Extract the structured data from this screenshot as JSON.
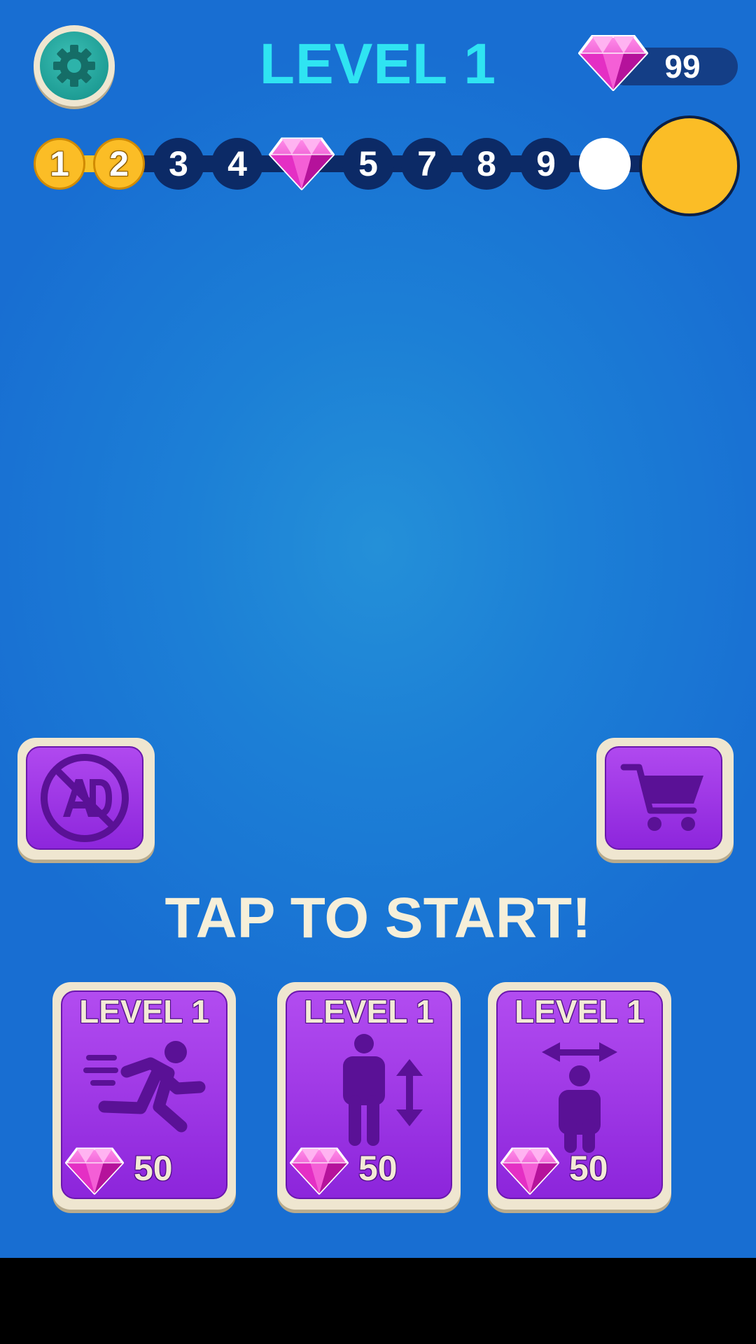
{
  "header": {
    "title": "LEVEL 1",
    "gem_count": "99",
    "settings_icon": "gear-icon",
    "gem_icon": "gem-icon"
  },
  "progress": {
    "nodes": [
      {
        "label": "1",
        "state": "completed"
      },
      {
        "label": "2",
        "state": "completed"
      },
      {
        "label": "3",
        "state": "upcoming"
      },
      {
        "label": "4",
        "state": "upcoming"
      },
      {
        "label": "",
        "state": "gem-reward",
        "icon": "gem-icon"
      },
      {
        "label": "5",
        "state": "upcoming"
      },
      {
        "label": "7",
        "state": "upcoming"
      },
      {
        "label": "8",
        "state": "upcoming"
      },
      {
        "label": "9",
        "state": "upcoming"
      },
      {
        "label": "",
        "state": "empty"
      },
      {
        "label": "",
        "state": "final"
      }
    ]
  },
  "buttons": {
    "no_ads_icon": "no-ads-icon",
    "shop_icon": "shopping-cart-icon"
  },
  "tap_to_start": "TAP TO START!",
  "upgrades": [
    {
      "label": "LEVEL 1",
      "icon": "running-man-icon",
      "price": "50",
      "currency_icon": "gem-icon"
    },
    {
      "label": "LEVEL 1",
      "icon": "height-person-icon",
      "price": "50",
      "currency_icon": "gem-icon"
    },
    {
      "label": "LEVEL 1",
      "icon": "width-person-icon",
      "price": "50",
      "currency_icon": "gem-icon"
    }
  ],
  "colors": {
    "background": "#1c7fd6",
    "title": "#2fe4f2",
    "gold": "#fbbd26",
    "track": "#0c2a66",
    "card_purple": "#9b35e4",
    "gem_pink": "#f04fd0"
  }
}
